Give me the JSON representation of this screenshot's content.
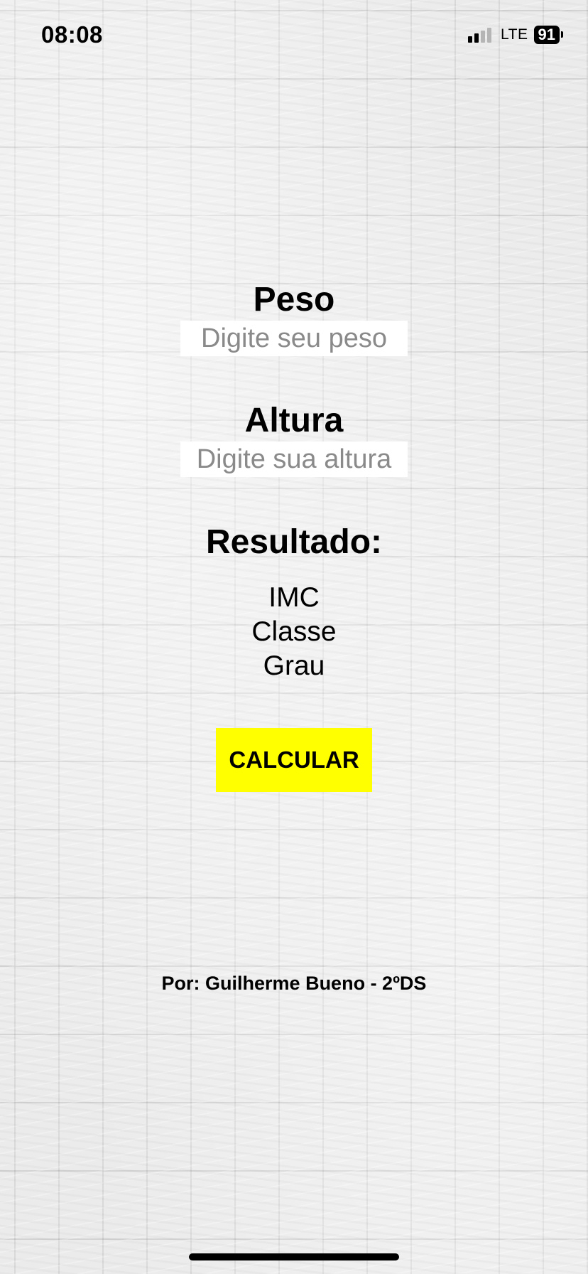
{
  "status_bar": {
    "time": "08:08",
    "network": "LTE",
    "battery": "91",
    "signal_bars_active": 2,
    "signal_bars_total": 4
  },
  "form": {
    "weight_label": "Peso",
    "weight_placeholder": "Digite seu peso",
    "height_label": "Altura",
    "height_placeholder": "Digite sua altura"
  },
  "result": {
    "title": "Resultado:",
    "imc": "IMC",
    "classe": "Classe",
    "grau": "Grau"
  },
  "button": {
    "label": "CALCULAR",
    "color": "#ffff00"
  },
  "footer": {
    "credit": "Por: Guilherme Bueno - 2ºDS"
  },
  "background": {
    "description_icon": "brick-wall-texture"
  }
}
